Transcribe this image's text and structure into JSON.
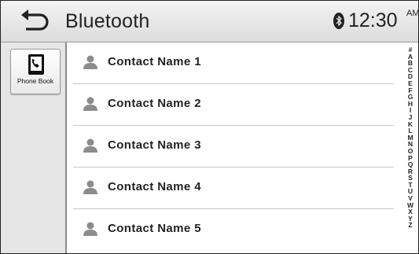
{
  "header": {
    "title": "Bluetooth",
    "time": "12:30",
    "ampm": "AM",
    "back_icon": "back-arrow-icon",
    "status_icon": "bluetooth-icon"
  },
  "sidebar": {
    "phone_book": {
      "label": "Phone Book",
      "icon": "phone-book-icon"
    }
  },
  "contacts": [
    {
      "name": "Contact Name 1",
      "icon": "person-icon"
    },
    {
      "name": "Contact Name 2",
      "icon": "person-icon"
    },
    {
      "name": "Contact Name 3",
      "icon": "person-icon"
    },
    {
      "name": "Contact Name 4",
      "icon": "person-icon"
    },
    {
      "name": "Contact Name 5",
      "icon": "person-icon"
    }
  ],
  "alpha_index": [
    "#",
    "A",
    "B",
    "C",
    "D",
    "E",
    "F",
    "G",
    "H",
    "I",
    "J",
    "K",
    "L",
    "M",
    "N",
    "O",
    "P",
    "Q",
    "R",
    "S",
    "T",
    "U",
    "V",
    "W",
    "X",
    "Y",
    "Z"
  ],
  "colors": {
    "header_bg": "#e4e4e4",
    "sidebar_bg": "#e6e6e6",
    "text": "#222222",
    "divider": "#c8c8c8",
    "person_icon": "#8c8c8c"
  }
}
